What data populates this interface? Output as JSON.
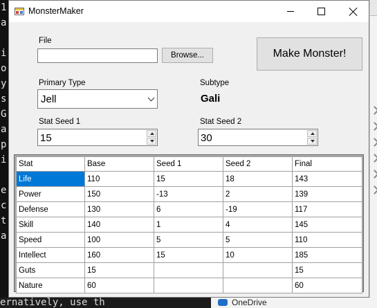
{
  "window": {
    "title": "MonsterMaker"
  },
  "background": {
    "left_chars": [
      "1",
      "a",
      "",
      "i",
      "o",
      "y",
      "s",
      "G",
      "a",
      "p",
      "i",
      "",
      "e",
      "c",
      "t",
      "a"
    ],
    "bottom_text": "ernatively, use th",
    "onedrive_label": "OneDrive"
  },
  "file": {
    "label": "File",
    "value": "",
    "browse_label": "Browse..."
  },
  "make_button_label": "Make Monster!",
  "primary_type": {
    "label": "Primary Type",
    "value": "Jell"
  },
  "subtype": {
    "label": "Subtype",
    "value": "Gali"
  },
  "stat_seed_1": {
    "label": "Stat Seed 1",
    "value": "15"
  },
  "stat_seed_2": {
    "label": "Stat Seed 2",
    "value": "30"
  },
  "grid": {
    "headers": [
      "Stat",
      "Base",
      "Seed 1",
      "Seed 2",
      "Final"
    ],
    "rows": [
      [
        "Life",
        "110",
        "15",
        "18",
        "143"
      ],
      [
        "Power",
        "150",
        "-13",
        "2",
        "139"
      ],
      [
        "Defense",
        "130",
        "6",
        "-19",
        "117"
      ],
      [
        "Skill",
        "140",
        "1",
        "4",
        "145"
      ],
      [
        "Speed",
        "100",
        "5",
        "5",
        "110"
      ],
      [
        "Intellect",
        "160",
        "15",
        "10",
        "185"
      ],
      [
        "Guts",
        "15",
        "",
        "",
        "15"
      ],
      [
        "Nature",
        "60",
        "",
        "",
        "60"
      ]
    ]
  },
  "colors": {
    "selection": "#0078d7",
    "window_bg": "#f0f0f0"
  }
}
